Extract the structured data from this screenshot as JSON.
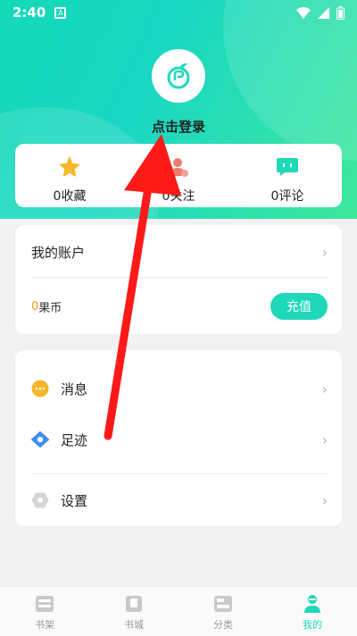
{
  "status_bar": {
    "time": "2:40",
    "notification_letter": "A"
  },
  "header": {
    "login_text": "点击登录"
  },
  "stats": [
    {
      "count": "0",
      "label": "收藏",
      "icon": "star-icon"
    },
    {
      "count": "0",
      "label": "关注",
      "icon": "follow-person-icon"
    },
    {
      "count": "0",
      "label": "评论",
      "icon": "comment-icon"
    }
  ],
  "account": {
    "title": "我的账户",
    "coin_count": "0",
    "coin_label": "果币",
    "recharge_label": "充值"
  },
  "menu": {
    "messages": "消息",
    "footprints": "足迹",
    "settings": "设置"
  },
  "tabs": [
    {
      "label": "书架",
      "icon": "bookshelf-icon",
      "active": false
    },
    {
      "label": "书城",
      "icon": "bookstore-icon",
      "active": false
    },
    {
      "label": "分类",
      "icon": "category-icon",
      "active": false
    },
    {
      "label": "我的",
      "icon": "profile-icon",
      "active": true
    }
  ],
  "colors": {
    "accent": "#1fd8ba",
    "coin": "#f39b1d",
    "star": "#f6b82a",
    "follow": "#f07a6b",
    "annotation_arrow": "#ff1a1a"
  }
}
